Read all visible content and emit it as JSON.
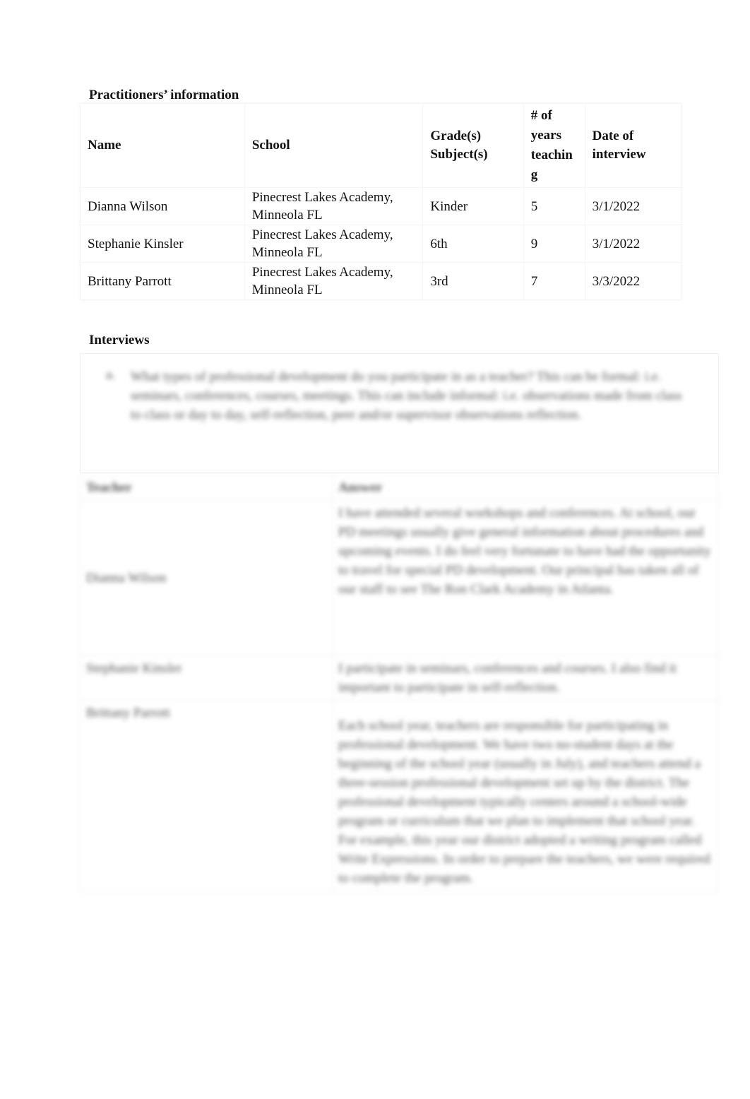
{
  "practitioners": {
    "title": "Practitioners’ information",
    "headers": [
      "Name",
      "School",
      "Grade(s)\nSubject(s)",
      "# of\nyears\nteachin\ng",
      "Date of\ninterview"
    ],
    "rows": [
      {
        "name": "Dianna Wilson",
        "school_line1": "Pinecrest Lakes Academy,",
        "school_line2": "Minneola FL",
        "grade": "Kinder",
        "years": "5",
        "date": "3/1/2022"
      },
      {
        "name": "Stephanie Kinsler",
        "school_line1": "Pinecrest Lakes Academy,",
        "school_line2": "Minneola FL",
        "grade": "6th",
        "years": "9",
        "date": "3/1/2022"
      },
      {
        "name": "Brittany Parrott",
        "school_line1": "Pinecrest Lakes Academy,",
        "school_line2": "Minneola FL",
        "grade": "3rd",
        "years": "7",
        "date": "3/3/2022"
      }
    ]
  },
  "interviews": {
    "title": "Interviews",
    "question_number": "a.",
    "question": "What types of professional development do you participate in as a teacher? This can be formal: i.e. seminars, conferences, courses, meetings. This can include informal: i.e. observations made from class to class or day to day, self-reflection, peer and/or supervisor observations reflection.",
    "headers": [
      "Teacher",
      "Answer"
    ],
    "responses": [
      {
        "teacher": "Dianna Wilson",
        "answer": "I have attended several workshops and conferences. At school, our PD meetings usually give general information about procedures and upcoming events. I do feel very fortunate to have had the opportunity to travel for special PD development. Our principal has taken all of our staff to see The Ron Clark Academy in Atlanta."
      },
      {
        "teacher": "Stephanie Kinsler",
        "answer": "I participate in seminars, conferences and courses. I also find it important to participate in self-reflection."
      },
      {
        "teacher": "Brittany Parrott",
        "answer": "Each school year, teachers are responsible for participating in professional development. We have two no-student days at the beginning of the school year (usually in July), and teachers attend a three-session professional development set up by the district. The professional development typically centers around a school-wide program or curriculum that we plan to implement that school year. For example, this year our district adopted a writing program called Write Expressions. In order to prepare the teachers, we were required to complete the program."
      }
    ]
  }
}
